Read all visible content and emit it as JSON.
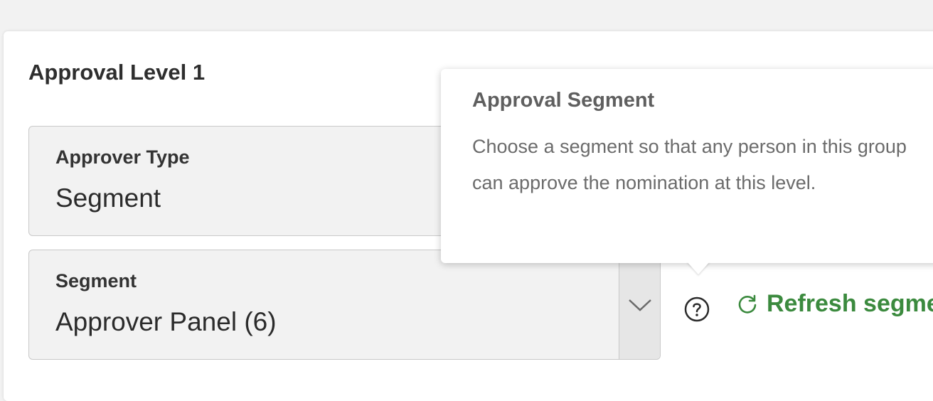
{
  "level": {
    "title": "Approval Level 1"
  },
  "approver_type": {
    "label": "Approver Type",
    "value": "Segment"
  },
  "segment": {
    "label": "Segment",
    "value": "Approver Panel (6)"
  },
  "refresh": {
    "label": "Refresh segme",
    "icon": "refresh-icon"
  },
  "help": {
    "icon": "question-circle-icon"
  },
  "tooltip": {
    "title": "Approval Segment",
    "body": "Choose a segment so that any person in this group can approve the nomination at this level."
  },
  "colors": {
    "accent_green": "#3b8a3e",
    "field_background": "#f2f2f2",
    "page_background": "#f2f2f2"
  }
}
